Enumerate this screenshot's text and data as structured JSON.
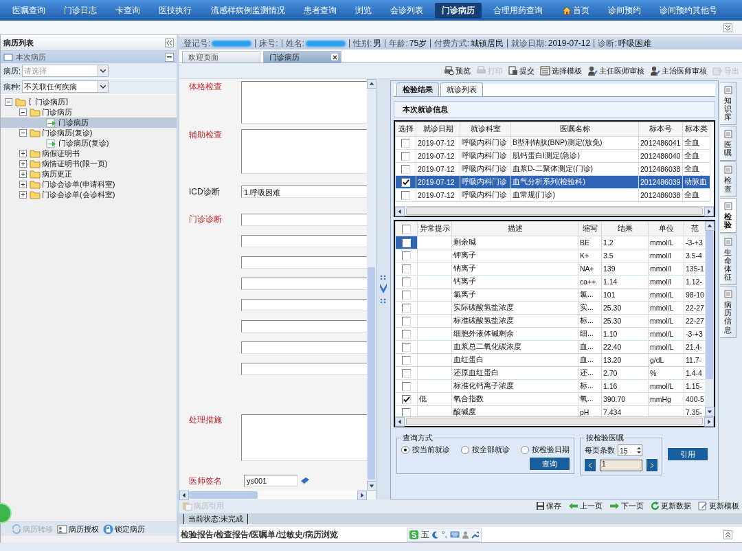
{
  "nav": [
    {
      "label": "医嘱查询",
      "kind": "plain",
      "selected": false
    },
    {
      "label": "门诊日志",
      "kind": "plain",
      "selected": false
    },
    {
      "label": "卡查询",
      "kind": "plain",
      "selected": false
    },
    {
      "label": "医技执行",
      "kind": "plain",
      "selected": false
    },
    {
      "label": "流感样病例监测情况",
      "kind": "plain",
      "selected": false
    },
    {
      "label": "患者查询",
      "kind": "plain",
      "selected": false
    },
    {
      "label": "浏览",
      "kind": "plain",
      "selected": false
    },
    {
      "label": "会诊列表",
      "kind": "plain",
      "selected": false
    },
    {
      "label": "门诊病历",
      "kind": "plain",
      "selected": true
    },
    {
      "label": "合理用药查询",
      "kind": "plain",
      "selected": false
    },
    {
      "label": "首页",
      "kind": "home",
      "selected": false
    },
    {
      "label": "诊间预约",
      "kind": "plain",
      "selected": false
    },
    {
      "label": "诊间预约其他号",
      "kind": "plain",
      "selected": false
    }
  ],
  "left_panel": {
    "title": "病历列表",
    "section": "本次病历",
    "filters": [
      {
        "label": "病历:",
        "placeholder": "请选择"
      },
      {
        "label": "病种:",
        "value": "不关联任何疾病"
      }
    ],
    "tree": [
      {
        "label": "〖门诊病历〗",
        "kind": "folder",
        "expanded": true,
        "selected": false,
        "children": [
          {
            "label": "门诊病历",
            "kind": "folder",
            "expanded": true,
            "selected": false,
            "children": [
              {
                "label": "门诊病历",
                "kind": "document",
                "selected": true
              }
            ]
          },
          {
            "label": "门诊病历(复诊)",
            "kind": "folder",
            "expanded": true,
            "selected": false,
            "children": [
              {
                "label": "门诊病历(复诊)",
                "kind": "document",
                "selected": false
              }
            ]
          },
          {
            "label": "病假证明书",
            "kind": "folder",
            "expanded": false,
            "selected": false
          },
          {
            "label": "病情证明书(限一页)",
            "kind": "folder",
            "expanded": false,
            "selected": false
          },
          {
            "label": "病历更正",
            "kind": "folder",
            "expanded": false,
            "selected": false
          },
          {
            "label": "门诊会诊单(申请科室)",
            "kind": "folder",
            "expanded": false,
            "selected": false
          },
          {
            "label": "门诊会诊单(会诊科室)",
            "kind": "folder",
            "expanded": false,
            "selected": false
          }
        ]
      }
    ],
    "actions": [
      {
        "label": "病历转移",
        "disabled": true
      },
      {
        "label": "病历授权",
        "disabled": false
      },
      {
        "label": "锁定病历",
        "disabled": false
      }
    ]
  },
  "patient_info": [
    {
      "label": "登记号:",
      "redacted": true
    },
    {
      "label": "床号:",
      "redacted": false
    },
    {
      "label": "姓名:",
      "redacted": true
    },
    {
      "label": "性别:",
      "value": "男",
      "redacted": false
    },
    {
      "label": "年龄:",
      "value": "75岁",
      "redacted": false
    },
    {
      "label": "付费方式:",
      "value": "城镇居民",
      "redacted": false
    },
    {
      "label": "就诊日期:",
      "value": "2019-07-12",
      "redacted": false
    },
    {
      "label": "诊断:",
      "value": "呼吸困难",
      "redacted": false
    }
  ],
  "doc_tabs": [
    {
      "label": "欢迎页面",
      "selected": false,
      "closable": false
    },
    {
      "label": "门诊病历",
      "selected": true,
      "closable": true
    }
  ],
  "toolbar": [
    {
      "label": "预览",
      "disabled": false
    },
    {
      "label": "打印",
      "disabled": true
    },
    {
      "label": "提交",
      "disabled": false
    },
    {
      "label": "选择模板",
      "disabled": false
    },
    {
      "label": "主任医师审核",
      "disabled": false
    },
    {
      "label": "主治医师审核",
      "disabled": false
    },
    {
      "label": "导出",
      "disabled": true
    }
  ],
  "form": [
    {
      "label": "体格检查",
      "kind": "textarea",
      "required": true
    },
    {
      "label": "辅助检查",
      "kind": "textarea",
      "required": true
    },
    {
      "label": "ICD诊断",
      "kind": "input",
      "required": false,
      "value": "1.呼吸困难"
    },
    {
      "label": "门诊诊断",
      "kind": "lines",
      "required": true
    },
    {
      "label": "处理措施",
      "kind": "textarea",
      "required": true
    },
    {
      "label": "医师签名",
      "kind": "signature",
      "required": true,
      "value": "ys001"
    }
  ],
  "form_action": {
    "label": "病历引用",
    "disabled": true
  },
  "results_panel": {
    "tabs": [
      {
        "label": "检验结果",
        "selected": true
      },
      {
        "label": "就诊列表",
        "selected": false
      }
    ],
    "section_title": "本次就诊信息",
    "orders": {
      "select_column": "选择",
      "columns": [
        "就诊日期",
        "就诊科室",
        "医嘱名称",
        "标本号",
        "标本类"
      ],
      "rows": [
        {
          "checked": false,
          "selected": false,
          "cells": [
            "2019-07-12",
            "呼吸内科门诊",
            "B型利钠肽(BNP)测定(放免)",
            "2012486041",
            "全血"
          ]
        },
        {
          "checked": false,
          "selected": false,
          "cells": [
            "2019-07-12",
            "呼吸内科门诊",
            "肌钙蛋白I测定(急诊)",
            "2012486040",
            "全血"
          ]
        },
        {
          "checked": false,
          "selected": false,
          "cells": [
            "2019-07-12",
            "呼吸内科门诊",
            "血浆D-二聚体测定(门诊)",
            "2012486038",
            "全血"
          ]
        },
        {
          "checked": true,
          "selected": true,
          "cells": [
            "2019-07-12",
            "呼吸内科门诊",
            "血气分析系列(检验科)",
            "2012486039",
            "动脉血"
          ]
        },
        {
          "checked": false,
          "selected": false,
          "cells": [
            "2019-07-12",
            "呼吸内科门诊",
            "血常规(门诊)",
            "2012486038",
            "全血"
          ]
        }
      ]
    },
    "results": {
      "all_checked": false,
      "columns": [
        "异常提示",
        "描述",
        "缩写",
        "结果",
        "单位",
        "范"
      ],
      "rows": [
        {
          "checked": false,
          "selected": true,
          "description": "剩余碱",
          "abbr": "BE",
          "result": "1.2",
          "unit": "mmol/L",
          "range": "-3-+3"
        },
        {
          "checked": false,
          "selected": false,
          "description": "钾离子",
          "abbr": "K+",
          "result": "3.5",
          "unit": "mmol/l",
          "range": "3.5-4"
        },
        {
          "checked": false,
          "selected": false,
          "description": "钠离子",
          "abbr": "NA+",
          "result": "139",
          "unit": "mmol/l",
          "range": "135-1"
        },
        {
          "checked": false,
          "selected": false,
          "description": "钙离子",
          "abbr": "ca++",
          "result": "1.14",
          "unit": "mmol/l",
          "range": "1.12-"
        },
        {
          "checked": false,
          "selected": false,
          "description": "氯离子",
          "abbr": "氯...",
          "result": "101",
          "unit": "mmol/L",
          "range": "98-10"
        },
        {
          "checked": false,
          "selected": false,
          "description": "实际碳酸氢盐浓度",
          "abbr": "实...",
          "result": "25.30",
          "unit": "mmol/L",
          "range": "22-27"
        },
        {
          "checked": false,
          "selected": false,
          "description": "标准碳酸氢盐浓度",
          "abbr": "标...",
          "result": "25.30",
          "unit": "mmol/L",
          "range": "22-27"
        },
        {
          "checked": false,
          "selected": false,
          "description": "细胞外液体碱剩余",
          "abbr": "细...",
          "result": "1.10",
          "unit": "mmol/L",
          "range": "-3-+3"
        },
        {
          "checked": false,
          "selected": false,
          "description": "血浆总二氧化碳浓度",
          "abbr": "血...",
          "result": "22.40",
          "unit": "mmol/L",
          "range": "21.4-"
        },
        {
          "checked": false,
          "selected": false,
          "description": "血红蛋白",
          "abbr": "血...",
          "result": "13.20",
          "unit": "g/dL",
          "range": "11.7-"
        },
        {
          "checked": false,
          "selected": false,
          "description": "还原血红蛋白",
          "abbr": "还...",
          "result": "2.70",
          "unit": "%",
          "range": "1.4-4"
        },
        {
          "checked": false,
          "selected": false,
          "description": "标准化钙离子浓度",
          "abbr": "标...",
          "result": "1.16",
          "unit": "mmol/L",
          "range": "1.15-"
        },
        {
          "checked": true,
          "selected": false,
          "flag": "低",
          "description": "氧合指数",
          "abbr": "氧...",
          "result": "390.70",
          "unit": "mmHg",
          "range": "400-5"
        },
        {
          "checked": false,
          "selected": false,
          "description": "酸碱度",
          "abbr": "pH",
          "result": "7.434",
          "range": "7.35-"
        }
      ]
    },
    "query": {
      "title": "查询方式",
      "options": [
        {
          "label": "按当前就诊",
          "selected": true
        },
        {
          "label": "按全部就诊",
          "selected": false
        },
        {
          "label": "按检验日期",
          "selected": false
        }
      ],
      "button": "查询",
      "paging": {
        "title": "按检验医嘱",
        "page_size_label": "每页条数",
        "page_size": "15",
        "page": "1"
      },
      "apply_button": "引用"
    }
  },
  "side_tabs": [
    {
      "label": "知识库",
      "selected": false
    },
    {
      "label": "医嘱",
      "selected": false
    },
    {
      "label": "检查",
      "selected": false
    },
    {
      "label": "检验",
      "selected": true
    },
    {
      "label": "生命体征",
      "selected": false
    },
    {
      "label": "病历信息",
      "selected": false
    }
  ],
  "bottom_toolbar": [
    {
      "label": "保存"
    },
    {
      "label": "上一页"
    },
    {
      "label": "下一页"
    },
    {
      "label": "更新数据"
    },
    {
      "label": "更新模板"
    }
  ],
  "status": "当前状态:未完成",
  "quick_links": "检验报告/检查报告/医嘱单/过敏史/病历浏览",
  "ime": {
    "mode": "五",
    "punctuation": "°,"
  }
}
